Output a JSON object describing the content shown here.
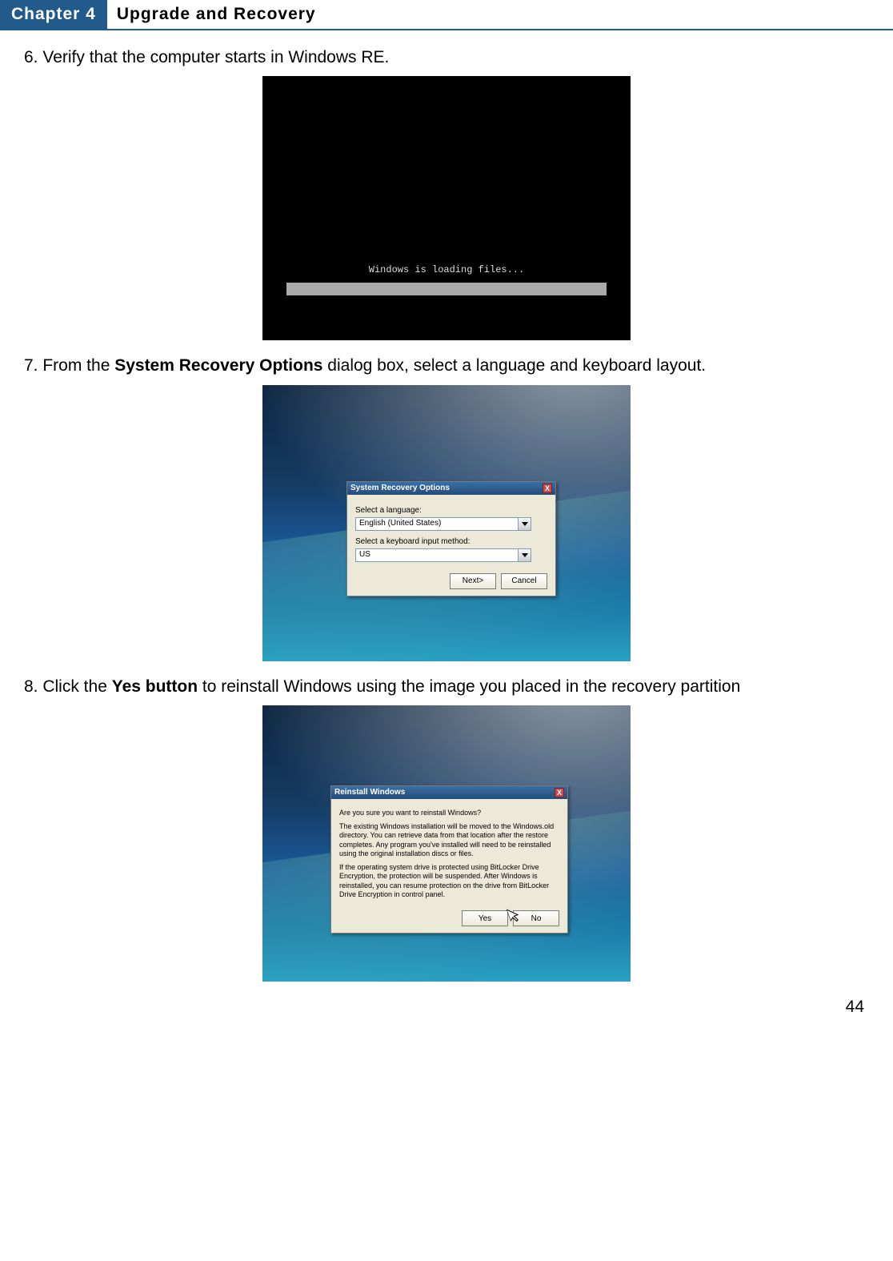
{
  "header": {
    "chapter_label": "Chapter 4",
    "chapter_title": "Upgrade and Recovery"
  },
  "steps": {
    "s6_prefix": "6. ",
    "s6_text": "Verify that the computer starts in Windows RE.",
    "s7_prefix": "7. From the ",
    "s7_bold": "System Recovery Options",
    "s7_suffix": " dialog box, select a language and keyboard layout.",
    "s8_prefix": "8. Click the ",
    "s8_bold": "Yes button",
    "s8_suffix": " to reinstall Windows using the image you placed in the recovery partition"
  },
  "fig1": {
    "loading_text": "Windows is loading files..."
  },
  "fig2": {
    "title": "System Recovery Options",
    "close_glyph": "X",
    "label_language": "Select a language:",
    "value_language": "English (United States)",
    "label_keyboard": "Select a keyboard input method:",
    "value_keyboard": "US",
    "btn_next": "Next>",
    "btn_cancel": "Cancel"
  },
  "fig3": {
    "title": "Reinstall Windows",
    "close_glyph": "X",
    "line1": "Are you sure you want to reinstall Windows?",
    "line2": "The existing Windows installation will be moved to the Windows.old directory.  You can retrieve data from that location after the restore completes.  Any program you've installed will need to be reinstalled using the original installation discs or files.",
    "line3": "If the operating system drive is protected using BitLocker Drive Encryption, the protection will be suspended.  After Windows is reinstalled, you can resume protection on the drive from BitLocker Drive Encryption in control panel.",
    "btn_yes": "Yes",
    "btn_no": "No"
  },
  "page_number": "44"
}
